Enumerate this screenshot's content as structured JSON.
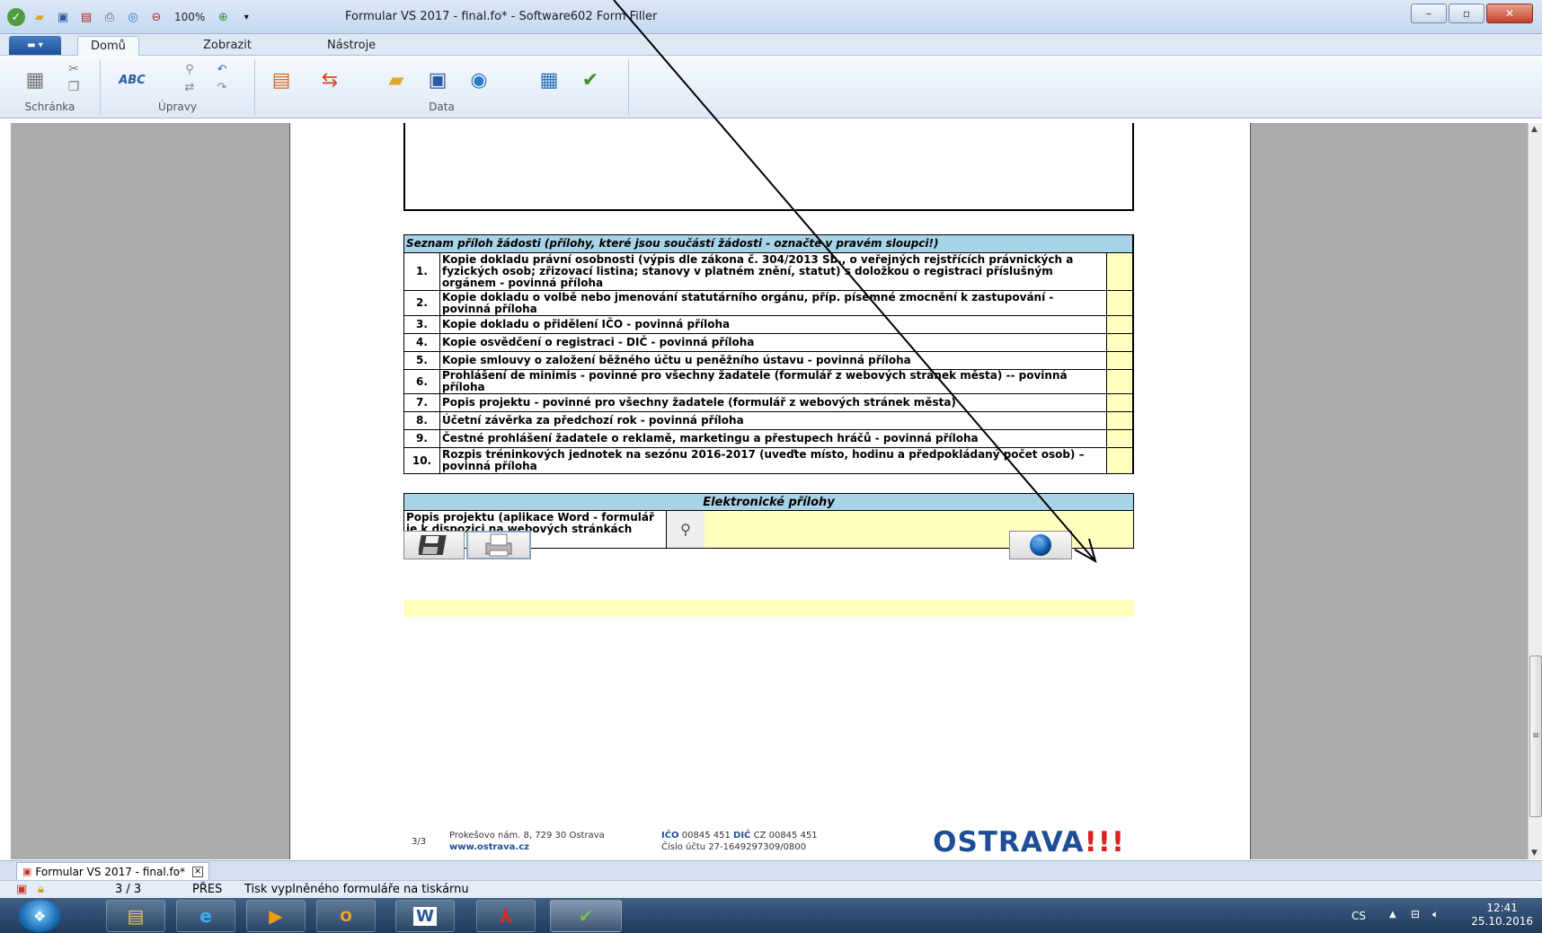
{
  "window": {
    "zoom": "100%",
    "title": "Formular VS 2017 - final.fo* - Software602 Form Filler",
    "minimize": "–",
    "restore": "▫",
    "close": "✕"
  },
  "ribbon": {
    "file_button": "▬ ▾",
    "tabs": [
      "Domů",
      "Zobrazit",
      "Nástroje"
    ],
    "groups": [
      "Schránka",
      "Úpravy",
      "Data"
    ]
  },
  "form": {
    "attachments_header": "Seznam příloh žádosti (přílohy, které jsou součástí žádosti - označte v pravém sloupci!)",
    "attachments": [
      {
        "num": "1.",
        "text": "Kopie dokladu právní osobnosti (výpis dle zákona č. 304/2013 Sb., o veřejných rejstřících právnických a fyzických osob; zřizovací listina; stanovy v platném znění, statut) s doložkou o registraci příslušným orgánem - povinná příloha"
      },
      {
        "num": "2.",
        "text": "Kopie dokladu o volbě nebo jmenování statutárního orgánu, příp. písemné zmocnění k zastupování - povinná příloha"
      },
      {
        "num": "3.",
        "text": "Kopie dokladu o přidělení IČO - povinná příloha"
      },
      {
        "num": "4.",
        "text": "Kopie osvědčení o registraci - DIČ - povinná příloha"
      },
      {
        "num": "5.",
        "text": "Kopie smlouvy o založení běžného účtu u peněžního ústavu - povinná příloha"
      },
      {
        "num": "6.",
        "text": "Prohlášení de minimis - povinné pro všechny žadatele (formulář z webových stránek města) -- povinná příloha"
      },
      {
        "num": "7.",
        "text": "Popis projektu - povinné pro všechny žadatele (formulář z webových stránek města)"
      },
      {
        "num": "8.",
        "text": "Účetní závěrka za předchozí rok - povinná příloha"
      },
      {
        "num": "9.",
        "text": "Čestné prohlášení žadatele o reklamě, marketingu a přestupech hráčů - povinná příloha"
      },
      {
        "num": "10.",
        "text": "Rozpis tréninkových jednotek na sezónu 2016-2017 (uveďte místo, hodinu a předpokládaný počet osob) – povinná příloha"
      }
    ],
    "electronic_header": "Elektronické přílohy",
    "electronic_label": "Popis projektu (aplikace Word - formulář je k dispozici na webových stránkách města):",
    "footer": {
      "page": "3/3",
      "address": "Prokešovo nám. 8, 729 30 Ostrava",
      "web": "www.ostrava.cz",
      "ico_label": "IČO",
      "ico_value": "00845 451",
      "dic_label": "DIČ",
      "dic_value": "CZ 00845 451",
      "account": "Číslo účtu 27-1649297309/0800",
      "logo": "OSTRAVA",
      "logo_suffix": "!!!"
    }
  },
  "doc_tab": {
    "label": "Formular VS 2017 - final.fo*",
    "close": "✕"
  },
  "status": {
    "page": "3 / 3",
    "mode": "PŘES",
    "message": "Tisk vyplněného formuláře na tiskárnu"
  },
  "taskbar": {
    "language": "CS",
    "time": "12:41",
    "date": "25.10.2016"
  },
  "icons": {
    "save": "floppy-icon",
    "print": "printer-icon",
    "send": "globe-icon",
    "attach": "magnifier-icon"
  }
}
